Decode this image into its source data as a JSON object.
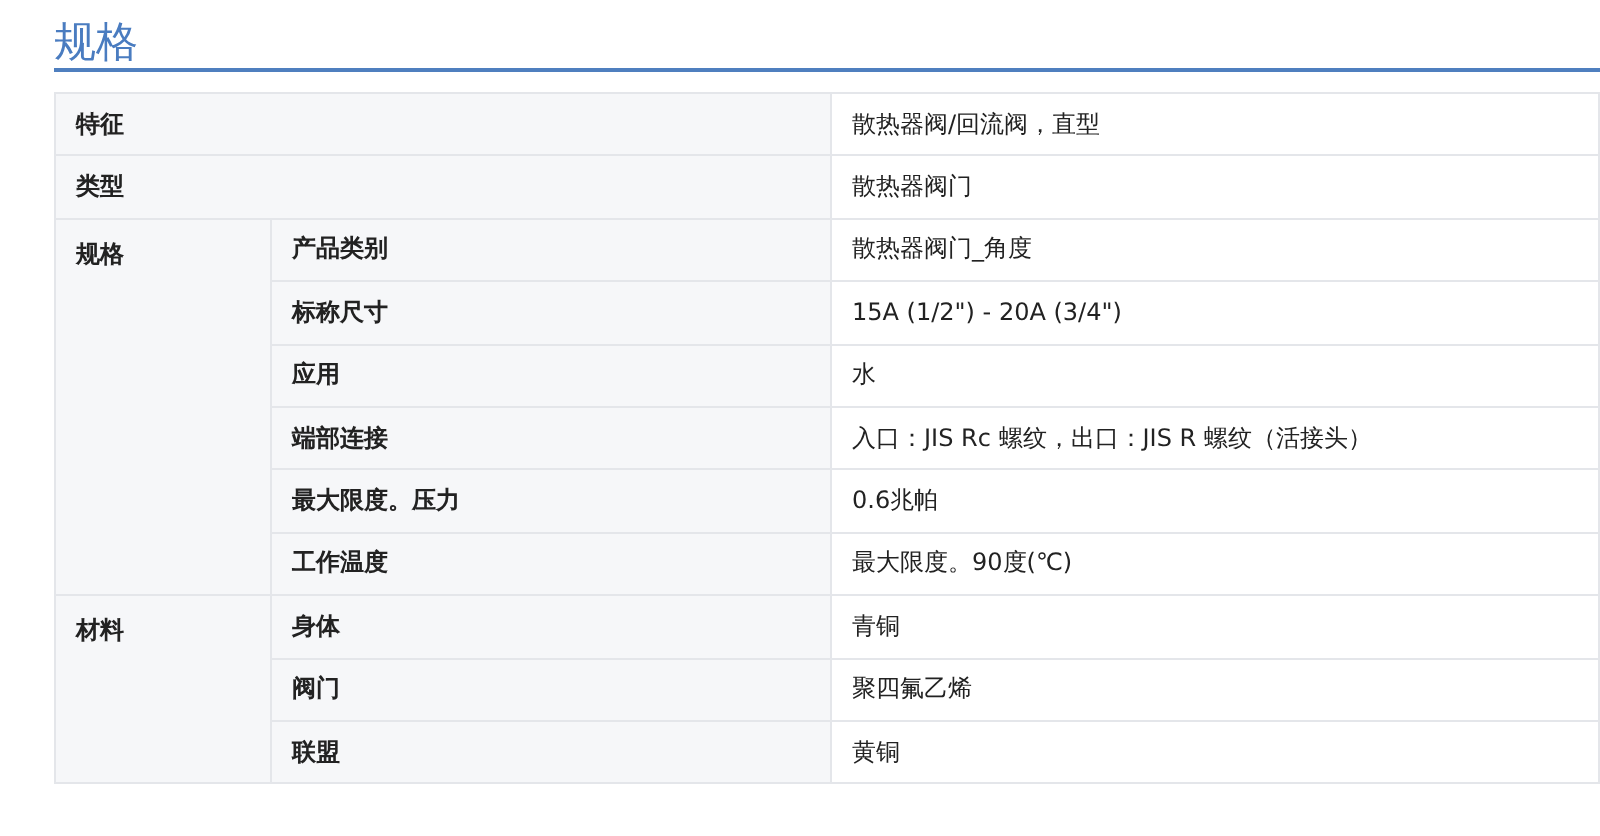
{
  "title": "规格",
  "rows": [
    {
      "label": "特征",
      "value": "散热器阀/回流阀，直型"
    },
    {
      "label": "类型",
      "value": "散热器阀门"
    },
    {
      "label": "规格",
      "children": [
        {
          "label": "产品类别",
          "value": "散热器阀门_角度"
        },
        {
          "label": "标称尺寸",
          "value": "15A (1/2\") - 20A (3/4\")"
        },
        {
          "label": "应用",
          "value": "水"
        },
        {
          "label": "端部连接",
          "value": "入口：JIS Rc 螺纹，出口：JIS R 螺纹（活接头）"
        },
        {
          "label": "最大限度。压力",
          "value": "0.6兆帕"
        },
        {
          "label": "工作温度",
          "value": "最大限度。90度(℃)"
        }
      ]
    },
    {
      "label": "材料",
      "children": [
        {
          "label": "身体",
          "value": "青铜"
        },
        {
          "label": "阀门",
          "value": "聚四氟乙烯"
        },
        {
          "label": "联盟",
          "value": "黄铜"
        }
      ]
    }
  ]
}
